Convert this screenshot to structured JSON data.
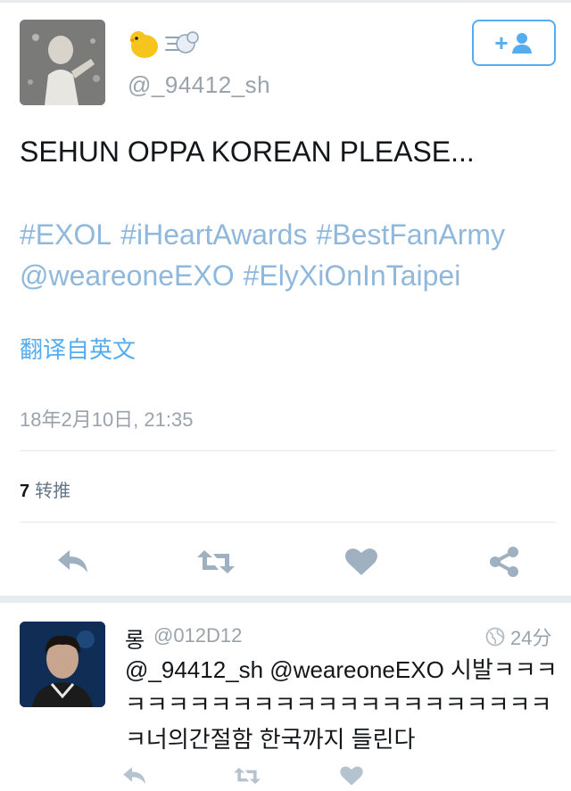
{
  "tweet": {
    "display_name_emoji": [
      "chick-emoji",
      "dash-emoji"
    ],
    "handle": "@_94412_sh",
    "text": "SEHUN OPPA KOREAN PLEASE...",
    "hashtags": [
      "#EXOL",
      "#iHeartAwards",
      "#BestFanArmy",
      "@weareoneEXO",
      "#ElyXiOnInTaipei"
    ],
    "translate_label": "翻译自英文",
    "timestamp": "18年2月10日, 21:35",
    "retweet_count": "7",
    "retweet_label": "转推"
  },
  "actions": [
    "reply-icon",
    "retweet-icon",
    "like-icon",
    "share-icon"
  ],
  "reply": {
    "name": "롱",
    "handle": "@012D12",
    "time": "24分",
    "text": "@_94412_sh @weareoneEXO 시발ㅋㅋㅋㅋㅋㅋㅋㅋㅋㅋㅋㅋㅋㅋㅋㅋㅋㅋㅋㅋㅋㅋㅋㅋ너의간절함 한국까지 들린다"
  },
  "colors": {
    "accent": "#55acee",
    "hashtag": "#8fb8dc",
    "muted": "#9aa3ab",
    "icon": "#9fb0c0"
  }
}
